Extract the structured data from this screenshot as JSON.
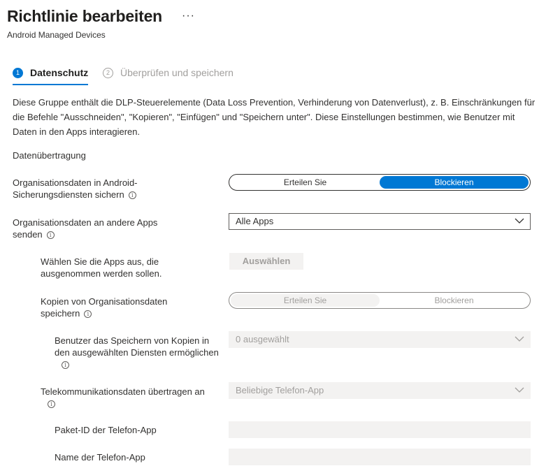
{
  "header": {
    "title": "Richtlinie bearbeiten",
    "more": "···",
    "subtitle": "Android Managed Devices"
  },
  "steps": [
    {
      "number": "1",
      "label": "Datenschutz",
      "active": true
    },
    {
      "number": "2",
      "label": "Überprüfen und speichern",
      "active": false
    }
  ],
  "description": "Diese Gruppe enthält die DLP-Steuerelemente (Data Loss Prevention, Verhinderung von Datenverlust), z. B. Einschränkungen für die Befehle \"Ausschneiden\", \"Kopieren\", \"Einfügen\" und \"Speichern unter\". Diese Einstellungen bestimmen, wie Benutzer mit Daten in den Apps interagieren.",
  "section_title": "Datenübertragung",
  "settings": {
    "backup": {
      "label": "Organisationsdaten in Android-Sicherungsdiensten sichern",
      "options": [
        "Erteilen Sie",
        "Blockieren"
      ],
      "selected": "Blockieren"
    },
    "send_data": {
      "label": "Organisationsdaten an andere Apps senden",
      "value": "Alle Apps"
    },
    "exempt_apps": {
      "label": "Wählen Sie die Apps aus, die ausgenommen werden sollen.",
      "button": "Auswählen"
    },
    "save_copies": {
      "label": "Kopien von Organisationsdaten speichern",
      "options": [
        "Erteilen Sie",
        "Blockieren"
      ],
      "selected": "Erteilen Sie"
    },
    "allow_services": {
      "label": "Benutzer das Speichern von Kopien in den ausgewählten Diensten ermöglichen",
      "value": "0 ausgewählt"
    },
    "telecom": {
      "label": "Telekommunikationsdaten übertragen an",
      "value": "Beliebige Telefon-App"
    },
    "package_id": {
      "label": "Paket-ID der Telefon-App",
      "value": ""
    },
    "app_name": {
      "label": "Name der Telefon-App",
      "value": ""
    }
  },
  "colors": {
    "accent": "#0078d4",
    "disabled_bg": "#f3f2f1",
    "disabled_text": "#a19f9d"
  }
}
